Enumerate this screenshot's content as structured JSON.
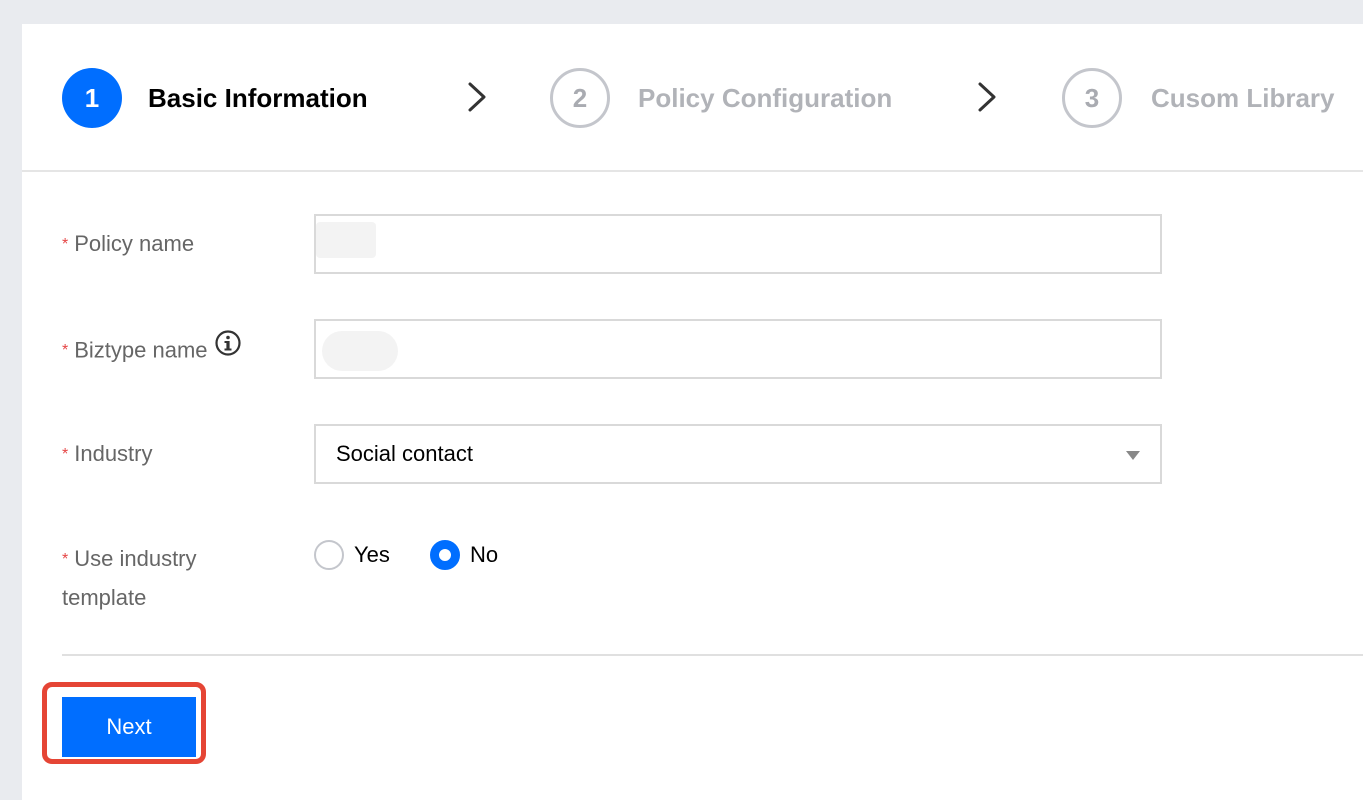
{
  "stepper": {
    "steps": [
      {
        "number": "1",
        "label": "Basic Information",
        "state": "active"
      },
      {
        "number": "2",
        "label": "Policy Configuration",
        "state": "inactive"
      },
      {
        "number": "3",
        "label": "Cusom Library",
        "state": "inactive"
      }
    ]
  },
  "form": {
    "required_mark": "*",
    "policy_name": {
      "label": "Policy name",
      "value": ""
    },
    "biztype_name": {
      "label": "Biztype name",
      "value": "",
      "icon": "info-icon"
    },
    "industry": {
      "label": "Industry",
      "selected": "Social contact"
    },
    "use_industry_template": {
      "label_line1": "Use industry",
      "label_line2": "template",
      "options": [
        {
          "label": "Yes",
          "checked": false
        },
        {
          "label": "No",
          "checked": true
        }
      ]
    }
  },
  "footer": {
    "next_label": "Next"
  },
  "colors": {
    "accent": "#006eff",
    "highlight": "#e54535",
    "required": "#e54545"
  }
}
